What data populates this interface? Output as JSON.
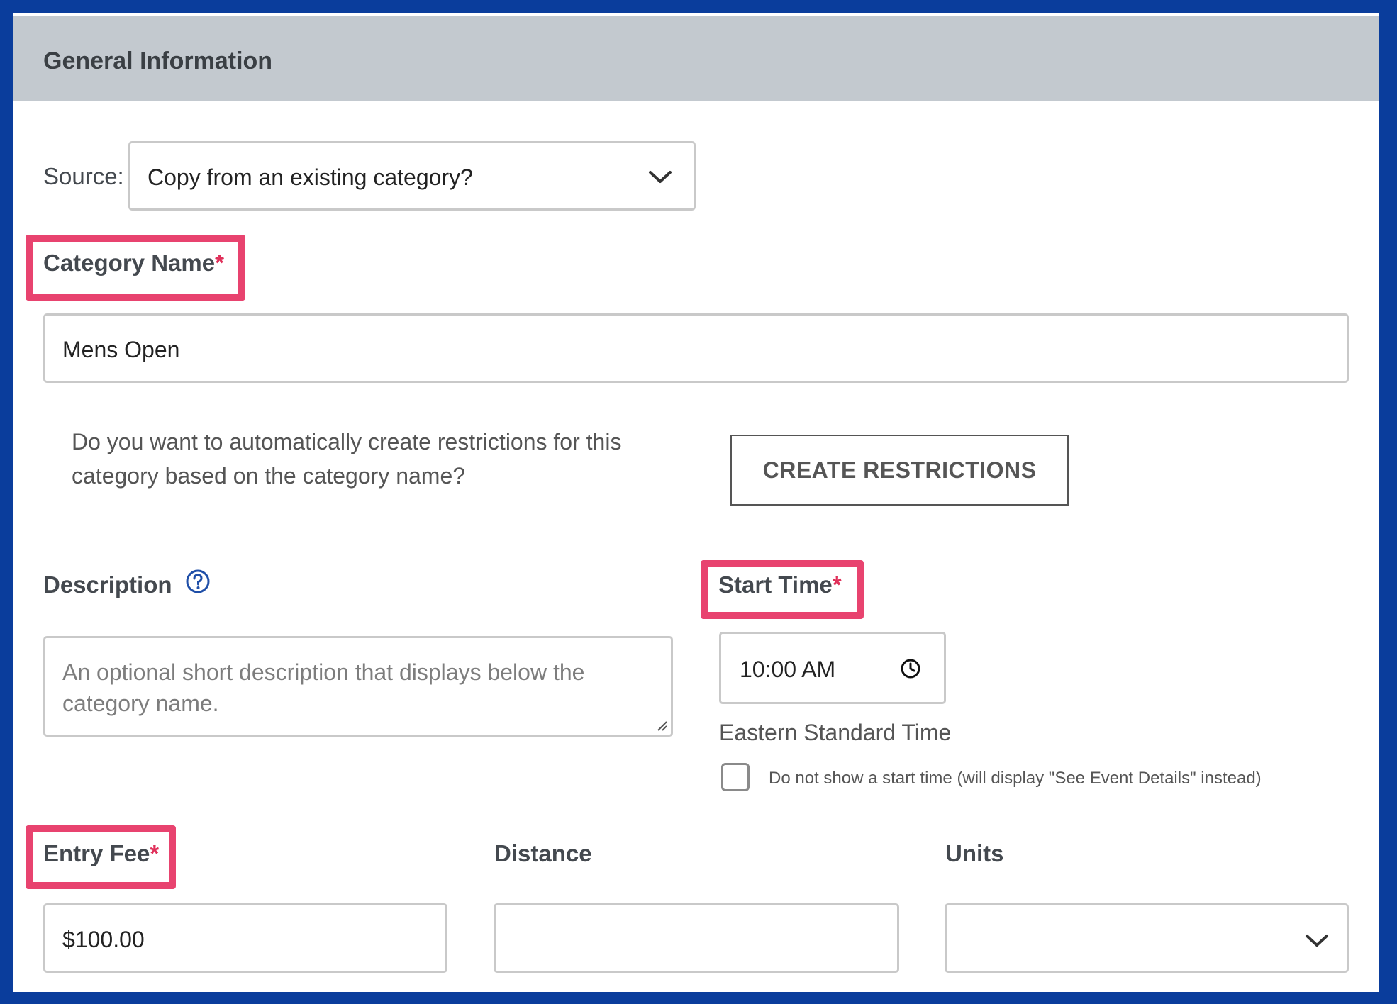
{
  "panel": {
    "title": "General Information"
  },
  "source": {
    "label": "Source:",
    "value": "Copy from an existing category?"
  },
  "category_name": {
    "label": "Category Name",
    "required_mark": "*",
    "value": "Mens Open"
  },
  "restrictions": {
    "question_line1": "Do you want to automatically create restrictions for this",
    "question_line2": "category based on the category name?",
    "button_label": "CREATE RESTRICTIONS"
  },
  "description": {
    "label": "Description",
    "placeholder_line1": "An optional short description that displays below the",
    "placeholder_line2": "category name.",
    "help_icon": "question-circle-icon"
  },
  "start_time": {
    "label": "Start Time",
    "required_mark": "*",
    "value": "10:00 AM",
    "timezone": "Eastern Standard Time",
    "hide_option": "Do not show a start time (will display \"See Event Details\" instead)",
    "hide_checked": false,
    "clock_icon": "clock-icon"
  },
  "entry_fee": {
    "label": "Entry Fee",
    "required_mark": "*",
    "value": "$100.00"
  },
  "distance": {
    "label": "Distance",
    "value": ""
  },
  "units": {
    "label": "Units",
    "value": ""
  },
  "colors": {
    "frame": "#0a3d9c",
    "header_bg": "#c3c9cf",
    "highlight": "#e8436f",
    "required": "#e0305a",
    "help_icon": "#1f4fa8"
  }
}
